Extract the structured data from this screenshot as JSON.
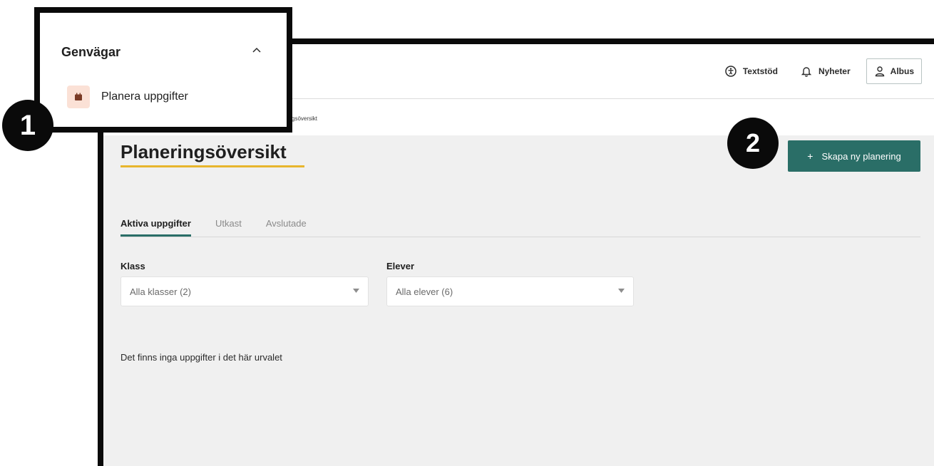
{
  "header": {
    "textstod_label": "Textstöd",
    "nyheter_label": "Nyheter",
    "user_label": "Albus"
  },
  "breadcrumb": {
    "current": "gsöversikt"
  },
  "page": {
    "title": "Planeringsöversikt",
    "create_button_label": "Skapa ny planering",
    "create_button_icon": "+"
  },
  "tabs": [
    {
      "label": "Aktiva uppgifter",
      "active": true
    },
    {
      "label": "Utkast",
      "active": false
    },
    {
      "label": "Avslutade",
      "active": false
    }
  ],
  "filters": {
    "class": {
      "label": "Klass",
      "value": "Alla klasser (2)"
    },
    "students": {
      "label": "Elever",
      "value": "Alla elever (6)"
    }
  },
  "empty_message": "Det finns inga uppgifter i det här urvalet",
  "shortcuts": {
    "title": "Genvägar",
    "items": [
      {
        "label": "Planera uppgifter",
        "icon": "calendar-icon"
      }
    ]
  },
  "callouts": {
    "one": "1",
    "two": "2"
  },
  "colors": {
    "accent": "#2a6e67",
    "title_underline": "#e8b52d",
    "shortcut_icon_bg": "#fbe1d6",
    "callout": "#0a0a0a"
  }
}
